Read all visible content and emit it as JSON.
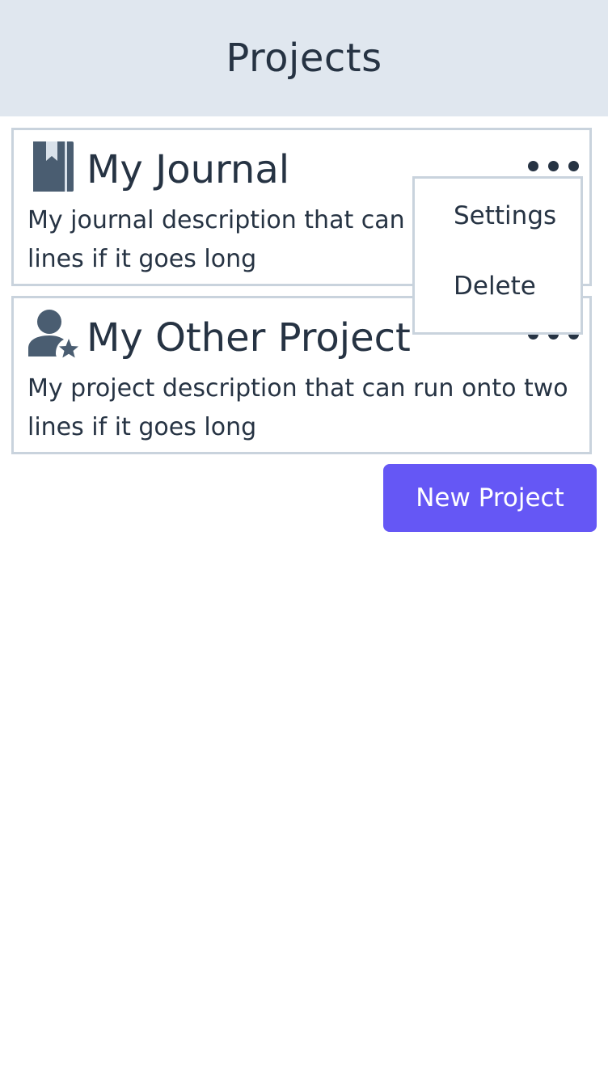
{
  "header": {
    "title": "Projects"
  },
  "projects": [
    {
      "title": "My Journal",
      "description": "My journal description that can run onto two lines if it goes long",
      "icon": "bookmark-book-icon"
    },
    {
      "title": "My Other Project",
      "description": "My project description that can run onto two lines if it goes long",
      "icon": "user-star-icon"
    }
  ],
  "menu": {
    "items": [
      {
        "label": "Settings"
      },
      {
        "label": "Delete"
      }
    ]
  },
  "actions": {
    "new_project_label": "New Project"
  },
  "colors": {
    "header_bg": "#e0e7ef",
    "text": "#263343",
    "accent": "#6557f5",
    "border": "#c9d3dd"
  }
}
